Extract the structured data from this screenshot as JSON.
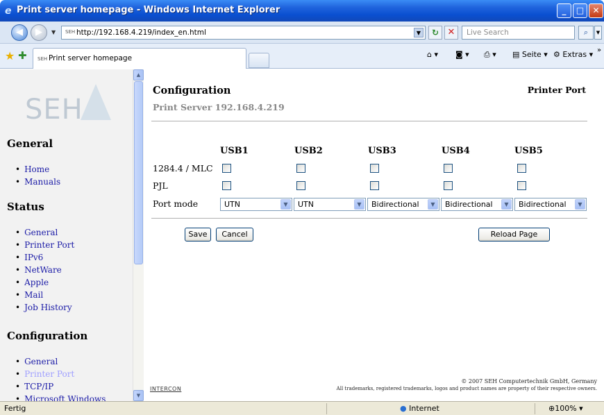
{
  "window": {
    "title": "Print server homepage - Windows Internet Explorer",
    "minimize": "_",
    "maximize": "□",
    "close": "✕"
  },
  "address": {
    "favicon": "SEH",
    "url": "http://192.168.4.219/index_en.html",
    "search_placeholder": "Live Search"
  },
  "tabbar": {
    "tab_favicon": "SEH",
    "tab_label": "Print server homepage",
    "page_menu": "Seite",
    "tools_menu": "Extras"
  },
  "sidebar": {
    "logo": "SEH",
    "sections": [
      {
        "heading": "General",
        "items": [
          "Home",
          "Manuals"
        ]
      },
      {
        "heading": "Status",
        "items": [
          "General",
          "Printer Port",
          "IPv6",
          "NetWare",
          "Apple",
          "Mail",
          "Job History"
        ]
      },
      {
        "heading": "Configuration",
        "items": [
          "General",
          "Printer Port",
          "TCP/IP",
          "Microsoft Windows"
        ]
      }
    ]
  },
  "main": {
    "title": "Configuration",
    "subtitle": "Print Server 192.168.4.219",
    "right_title": "Printer Port",
    "columns": [
      "USB1",
      "USB2",
      "USB3",
      "USB4",
      "USB5"
    ],
    "rows": [
      "1284.4 / MLC",
      "PJL",
      "Port mode"
    ],
    "port_modes": [
      "UTN",
      "UTN",
      "Bidirectional",
      "Bidirectional",
      "Bidirectional"
    ],
    "buttons": {
      "save": "Save",
      "cancel": "Cancel",
      "reload": "Reload Page"
    },
    "footer_logo": "INTERCON",
    "footer_copyright": "© 2007 SEH Computertechnik GmbH, Germany",
    "footer_trademarks": "All trademarks, registered trademarks, logos and product names are property of their respective owners."
  },
  "statusbar": {
    "status": "Fertig",
    "zone": "Internet",
    "zoom": "100%"
  }
}
